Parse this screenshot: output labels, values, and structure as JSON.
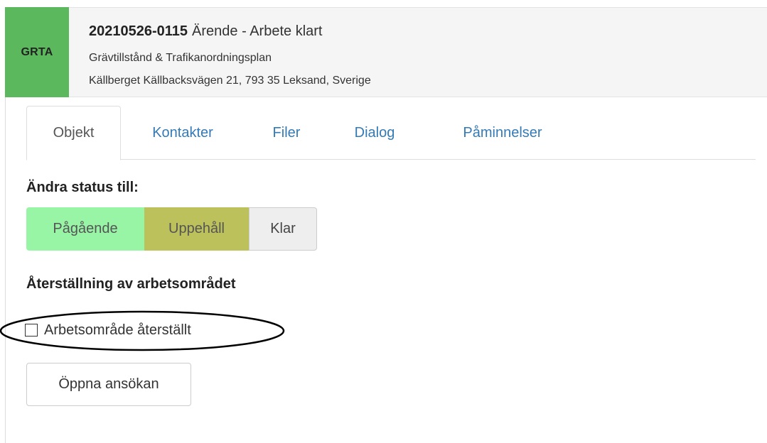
{
  "case": {
    "badge": "GRTA",
    "id": "20210526-0115",
    "title": "Ärende - Arbete klart",
    "type": "Grävtillstånd & Trafikanordningsplan",
    "address": "Källberget Källbacksvägen 21, 793 35 Leksand, Sverige",
    "badge_color": "#5cb85c"
  },
  "tabs": [
    {
      "label": "Objekt",
      "active": true
    },
    {
      "label": "Kontakter",
      "active": false
    },
    {
      "label": "Filer",
      "active": false
    },
    {
      "label": "Dialog",
      "active": false
    },
    {
      "label": "Påminnelser",
      "active": false
    }
  ],
  "status": {
    "heading": "Ändra status till:",
    "buttons": [
      {
        "label": "Pågående",
        "color": "#98f5a6"
      },
      {
        "label": "Uppehåll",
        "color": "#bcc15b"
      },
      {
        "label": "Klar",
        "color": "#eeeeee"
      }
    ]
  },
  "restoration": {
    "heading": "Återställning av arbetsområdet",
    "checkbox_label": "Arbetsområde återställt",
    "checked": false
  },
  "actions": {
    "open_application_label": "Öppna ansökan"
  }
}
